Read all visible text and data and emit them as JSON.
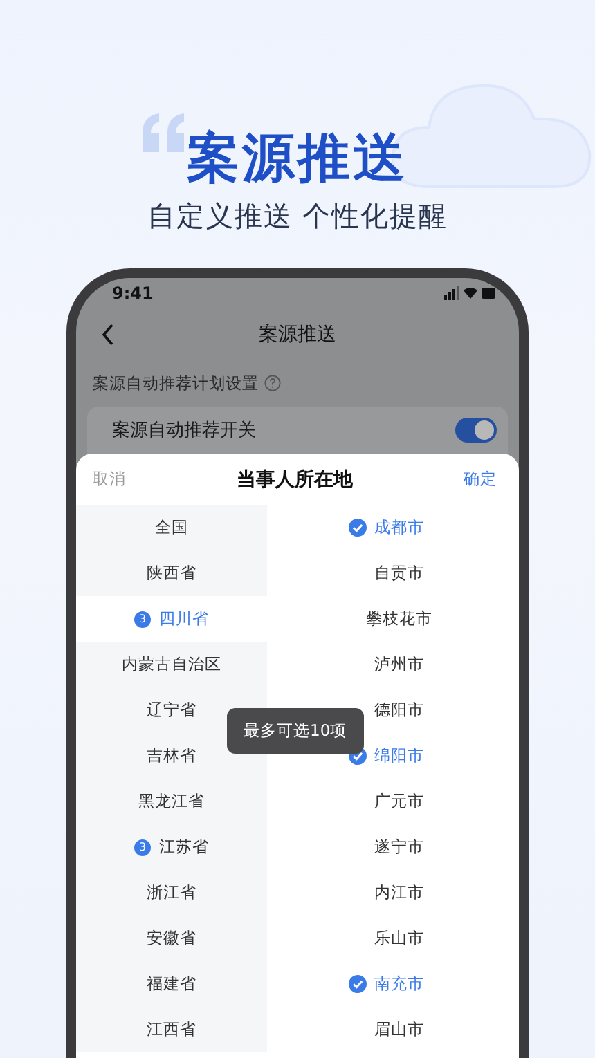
{
  "hero": {
    "title": "案源推送",
    "subtitle": "自定义推送 个性化提醒"
  },
  "status_bar": {
    "time": "9:41"
  },
  "nav": {
    "title": "案源推送"
  },
  "section": {
    "label": "案源自动推荐计划设置"
  },
  "switch_row": {
    "label": "案源自动推荐开关",
    "on": true
  },
  "sheet": {
    "cancel": "取消",
    "title": "当事人所在地",
    "confirm": "确定",
    "provinces": [
      {
        "name": "全国",
        "selected": false
      },
      {
        "name": "陕西省",
        "selected": false
      },
      {
        "name": "四川省",
        "selected": true,
        "count": "3"
      },
      {
        "name": "内蒙古自治区",
        "selected": false
      },
      {
        "name": "辽宁省",
        "selected": false
      },
      {
        "name": "吉林省",
        "selected": false
      },
      {
        "name": "黑龙江省",
        "selected": false
      },
      {
        "name": "江苏省",
        "selected": false,
        "count": "3"
      },
      {
        "name": "浙江省",
        "selected": false
      },
      {
        "name": "安徽省",
        "selected": false
      },
      {
        "name": "福建省",
        "selected": false
      },
      {
        "name": "江西省",
        "selected": false
      }
    ],
    "cities": [
      {
        "name": "成都市",
        "checked": true
      },
      {
        "name": "自贡市",
        "checked": false
      },
      {
        "name": "攀枝花市",
        "checked": false
      },
      {
        "name": "泸州市",
        "checked": false
      },
      {
        "name": "德阳市",
        "checked": false
      },
      {
        "name": "绵阳市",
        "checked": true
      },
      {
        "name": "广元市",
        "checked": false
      },
      {
        "name": "遂宁市",
        "checked": false
      },
      {
        "name": "内江市",
        "checked": false
      },
      {
        "name": "乐山市",
        "checked": false
      },
      {
        "name": "南充市",
        "checked": true
      },
      {
        "name": "眉山市",
        "checked": false
      }
    ]
  },
  "toast": "最多可选10项"
}
